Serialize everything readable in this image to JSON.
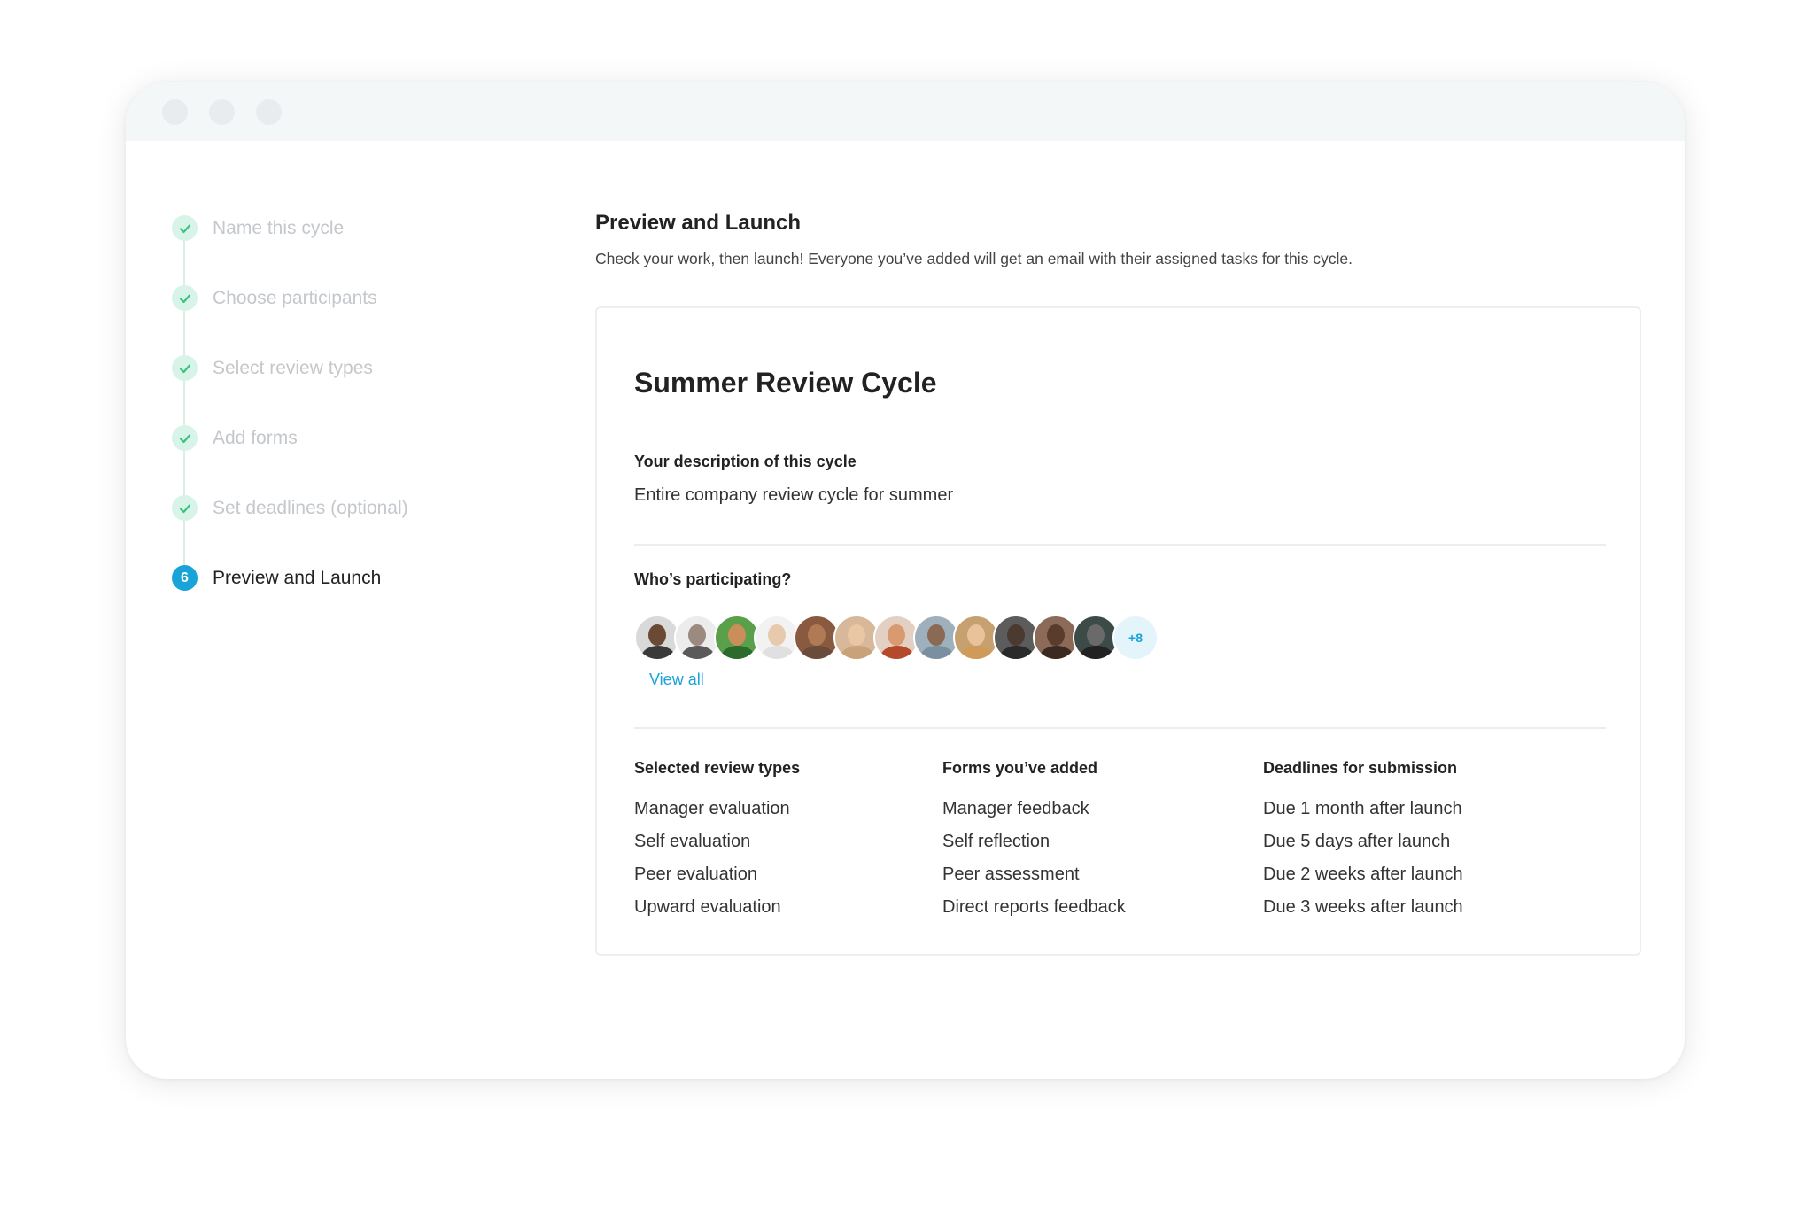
{
  "window": {
    "controls": [
      "window-dot",
      "window-dot",
      "window-dot"
    ]
  },
  "stepper": {
    "steps": [
      {
        "label": "Name this cycle",
        "state": "done"
      },
      {
        "label": "Choose participants",
        "state": "done"
      },
      {
        "label": "Select review types",
        "state": "done"
      },
      {
        "label": "Add forms",
        "state": "done"
      },
      {
        "label": "Set deadlines (optional)",
        "state": "done"
      },
      {
        "label": "Preview and Launch",
        "state": "active",
        "number": "6"
      }
    ]
  },
  "main": {
    "title": "Preview and Launch",
    "subtitle": "Check your work, then launch! Everyone you’ve added will get an email with their assigned tasks for this cycle."
  },
  "card": {
    "cycle_title": "Summer Review Cycle",
    "description_label": "Your description of this cycle",
    "description_value": "Entire company review cycle for summer",
    "participants_label": "Who’s participating?",
    "participants_more": "+8",
    "view_all": "View all",
    "columns": [
      {
        "heading": "Selected review types",
        "items": [
          "Manager evaluation",
          "Self evaluation",
          "Peer evaluation",
          "Upward evaluation"
        ]
      },
      {
        "heading": "Forms you’ve added",
        "items": [
          "Manager feedback",
          "Self reflection",
          "Peer assessment",
          "Direct reports feedback"
        ]
      },
      {
        "heading": "Deadlines for submission",
        "items": [
          "Due 1 month after launch",
          "Due 5 days after launch",
          "Due 2 weeks after launch",
          "Due 3 weeks after launch"
        ]
      }
    ]
  },
  "colors": {
    "accent": "#1aa3d9",
    "check_bg": "#d8f3e7",
    "check_mark": "#3cc27f",
    "muted_text": "#c4c8cc"
  },
  "avatars": [
    {
      "skin": "#6b4a35",
      "shirt": "#3a3a3a",
      "bg": "#d9d9d9"
    },
    {
      "skin": "#9a8a80",
      "shirt": "#5a5a5a",
      "bg": "#ececec"
    },
    {
      "skin": "#c98e5a",
      "shirt": "#2d6a2d",
      "bg": "#5aa04a"
    },
    {
      "skin": "#e7c9ad",
      "shirt": "#e0e0e0",
      "bg": "#f2f2f2"
    },
    {
      "skin": "#b07a55",
      "shirt": "#6b4b3a",
      "bg": "#8a5a40"
    },
    {
      "skin": "#e9c6a4",
      "shirt": "#c9a27a",
      "bg": "#d7b89a"
    },
    {
      "skin": "#d99a72",
      "shirt": "#b44a2a",
      "bg": "#e3d0c2"
    },
    {
      "skin": "#8a6a55",
      "shirt": "#7a8fa0",
      "bg": "#9fb0bd"
    },
    {
      "skin": "#e8c39a",
      "shirt": "#d09a5a",
      "bg": "#c7a070"
    },
    {
      "skin": "#4a3a30",
      "shirt": "#2a2a2a",
      "bg": "#5c5c5c"
    },
    {
      "skin": "#5a3c2c",
      "shirt": "#3a2a22",
      "bg": "#8b6a58"
    },
    {
      "skin": "#6a6a6a",
      "shirt": "#222222",
      "bg": "#3c4a48"
    }
  ]
}
